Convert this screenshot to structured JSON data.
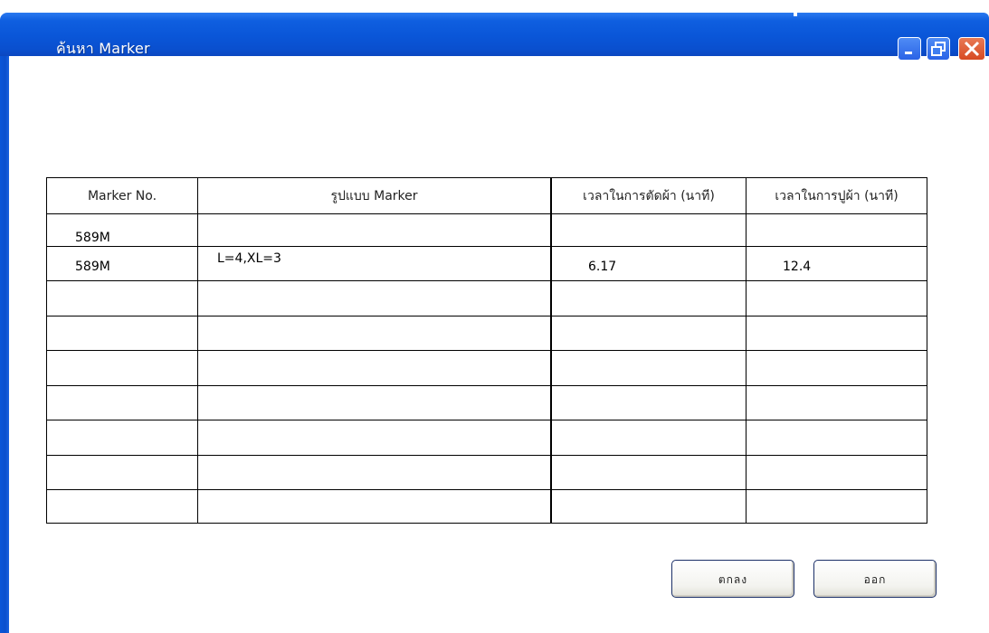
{
  "window": {
    "title": "ค้นหา Marker"
  },
  "table": {
    "headers": [
      "Marker No.",
      "รูปแบบ Marker",
      "เวลาในการตัดผ้า (นาที)",
      "เวลาในการปูผ้า (นาที)"
    ],
    "rows": [
      [
        "589M",
        "",
        "",
        ""
      ],
      [
        "589M",
        "L=4,XL=3",
        "6.17",
        "12.4"
      ],
      [
        "",
        "",
        "",
        ""
      ],
      [
        "",
        "",
        "",
        ""
      ],
      [
        "",
        "",
        "",
        ""
      ],
      [
        "",
        "",
        "",
        ""
      ],
      [
        "",
        "",
        "",
        ""
      ],
      [
        "",
        "",
        "",
        ""
      ],
      [
        "",
        "",
        "",
        ""
      ]
    ]
  },
  "buttons": {
    "ok": "ตกลง",
    "exit": "ออก"
  },
  "colors": {
    "titlebar": "#0a56d8",
    "close_button": "#d74a22"
  }
}
